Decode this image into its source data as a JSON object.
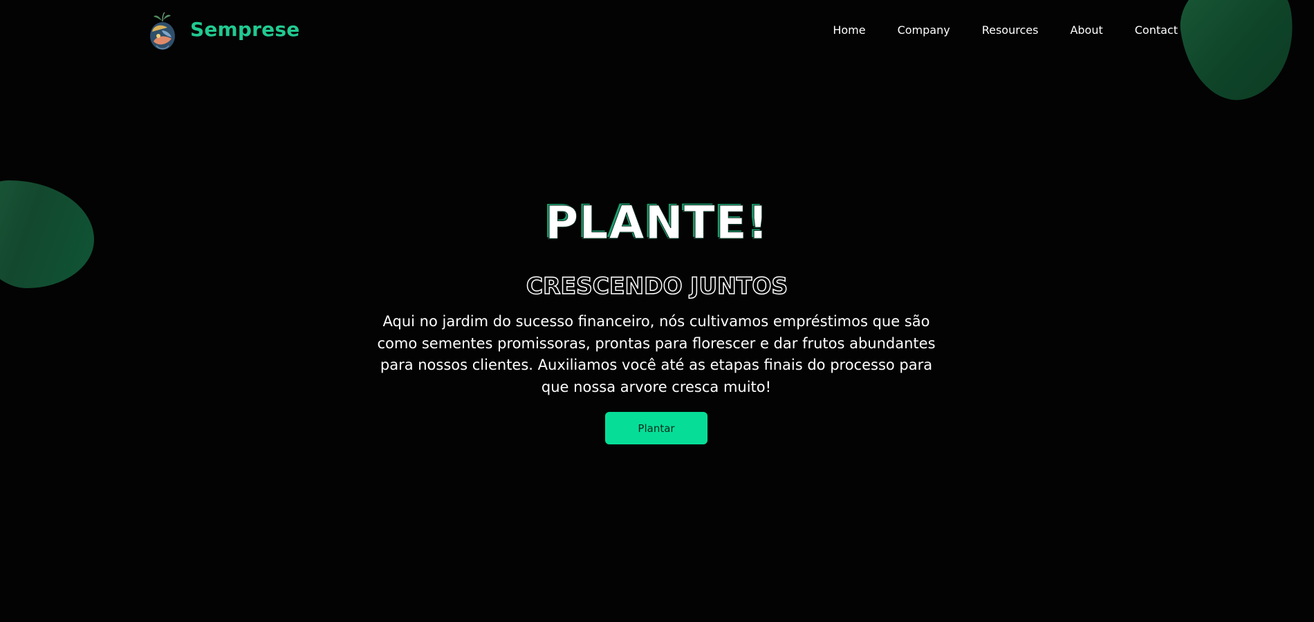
{
  "header": {
    "brand": "Semprese",
    "nav": [
      "Home",
      "Company",
      "Resources",
      "About",
      "Contact"
    ]
  },
  "hero": {
    "title": "PLANTE!",
    "subtitle": "CRESCENDO JUNTOS",
    "text": "Aqui no jardim do sucesso financeiro, nós cultivamos empréstimos que são como sementes promissoras, prontas para florescer e dar frutos abundantes para nossos clientes. Auxiliamos você até as etapas finais do processo para que nossa arvore cresca muito!",
    "button": "Plantar"
  },
  "colors": {
    "background": "#030303",
    "brand": "#21c990",
    "button": "#06de97",
    "blob": "#13482e"
  },
  "icons": {
    "logo": "plant-logo-icon"
  }
}
